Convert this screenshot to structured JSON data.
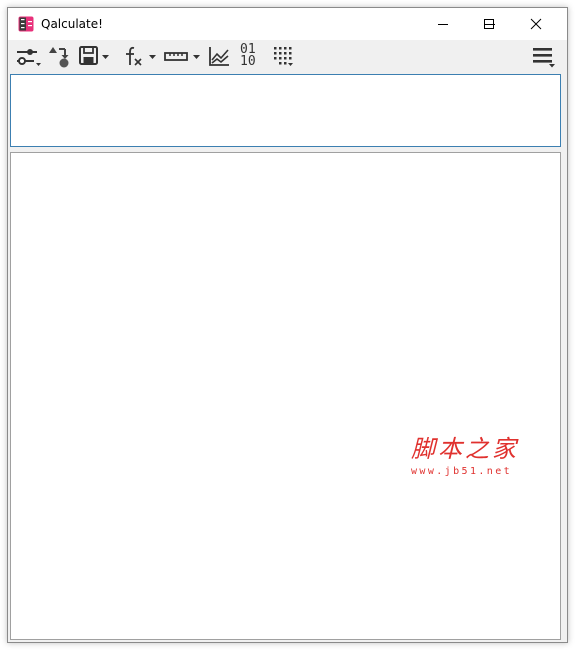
{
  "window": {
    "title": "Qalculate!",
    "controls": {
      "minimize": "minimize",
      "maximize": "maximize",
      "close": "close"
    }
  },
  "toolbar": {
    "items": [
      {
        "name": "mode",
        "icon": "sliders-icon",
        "dropdown": true
      },
      {
        "name": "store",
        "icon": "store-variable-icon",
        "dropdown": false
      },
      {
        "name": "save",
        "icon": "floppy-disk-icon",
        "dropdown": true
      },
      {
        "name": "functions",
        "icon": "function-fx-icon",
        "dropdown": true
      },
      {
        "name": "units",
        "icon": "ruler-icon",
        "dropdown": true
      },
      {
        "name": "plot",
        "icon": "chart-icon",
        "dropdown": false
      },
      {
        "name": "number-bases",
        "icon": "binary-icon",
        "label_top": "01",
        "label_bottom": "10",
        "dropdown": false
      },
      {
        "name": "keypad",
        "icon": "keypad-grid-icon",
        "dropdown": true
      },
      {
        "name": "menu",
        "icon": "hamburger-menu-icon",
        "dropdown": true
      }
    ]
  },
  "expression": {
    "value": "",
    "placeholder": ""
  },
  "result": {
    "text": ""
  },
  "watermark": {
    "text": "脚本之家",
    "url": "www.jb51.net"
  },
  "colors": {
    "accent": "#3c7fb1",
    "app_icon_pink": "#e8307a",
    "watermark": "#e0312e",
    "toolbar_bg": "#f0f0f0",
    "icon": "#333333"
  }
}
